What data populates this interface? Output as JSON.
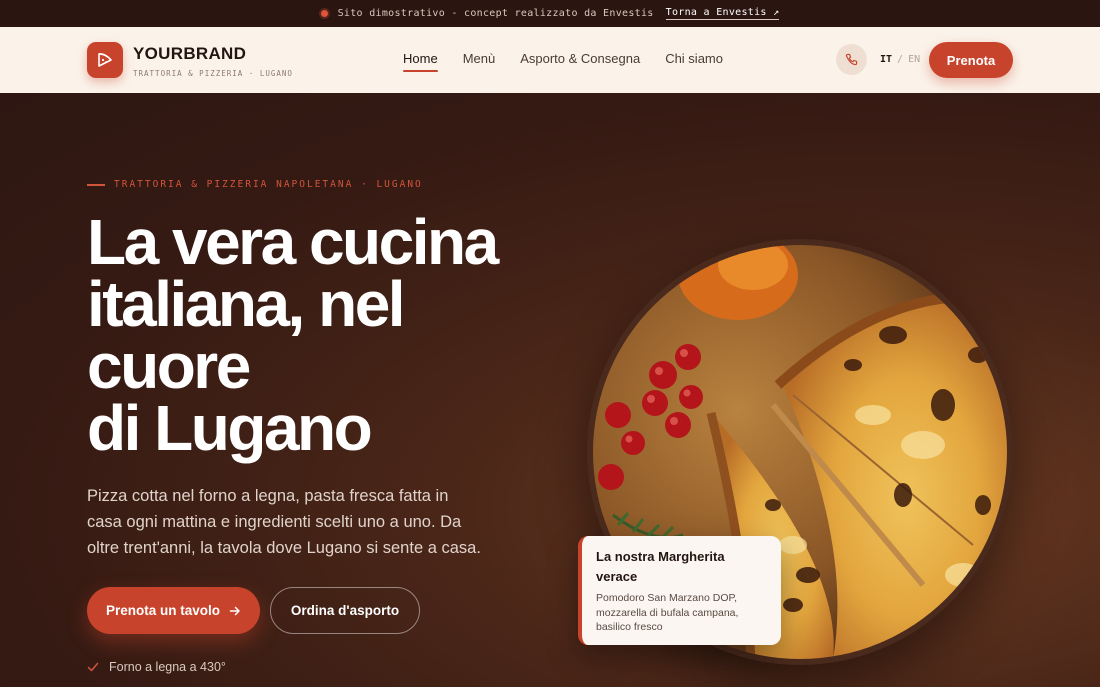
{
  "demo_bar": {
    "text": "Sito dimostrativo - concept realizzato da Envestis",
    "link": "Torna a Envestis ↗"
  },
  "header": {
    "brand_name": "YOURBRAND",
    "brand_sub": "TRATTORIA & PIZZERIA · LUGANO",
    "nav": [
      "Home",
      "Menù",
      "Asporto & Consegna",
      "Chi siamo"
    ],
    "lang_active": "IT",
    "lang_sep": "/",
    "lang_other": "EN",
    "book_label": "Prenota"
  },
  "hero": {
    "eyebrow": "TRATTORIA & PIZZERIA NAPOLETANA · LUGANO",
    "headline_lines": [
      "La vera cucina",
      "italiana, nel",
      "cuore",
      "di Lugano"
    ],
    "lead": "Pizza cotta nel forno a legna, pasta fresca fatta in casa ogni mattina e ingredienti scelti uno a uno. Da oltre trent'anni, la tavola dove Lugano si sente a casa.",
    "primary_cta": "Prenota un tavolo",
    "secondary_cta": "Ordina d'asporto",
    "feature": "Forno a legna a 430°"
  },
  "card": {
    "title": "La nostra Margherita verace",
    "text": "Pomodoro San Marzano DOP, mozzarella di bufala campana, basilico fresco"
  },
  "colors": {
    "accent": "#c8432b",
    "header_bg": "#fbf3ea",
    "hero_bg": "#3a1e16",
    "demo_bar_bg": "#2a1510"
  },
  "icons": [
    "pizza-logo-icon",
    "phone-icon",
    "arrow-right-icon",
    "check-icon",
    "external-arrow-icon"
  ]
}
